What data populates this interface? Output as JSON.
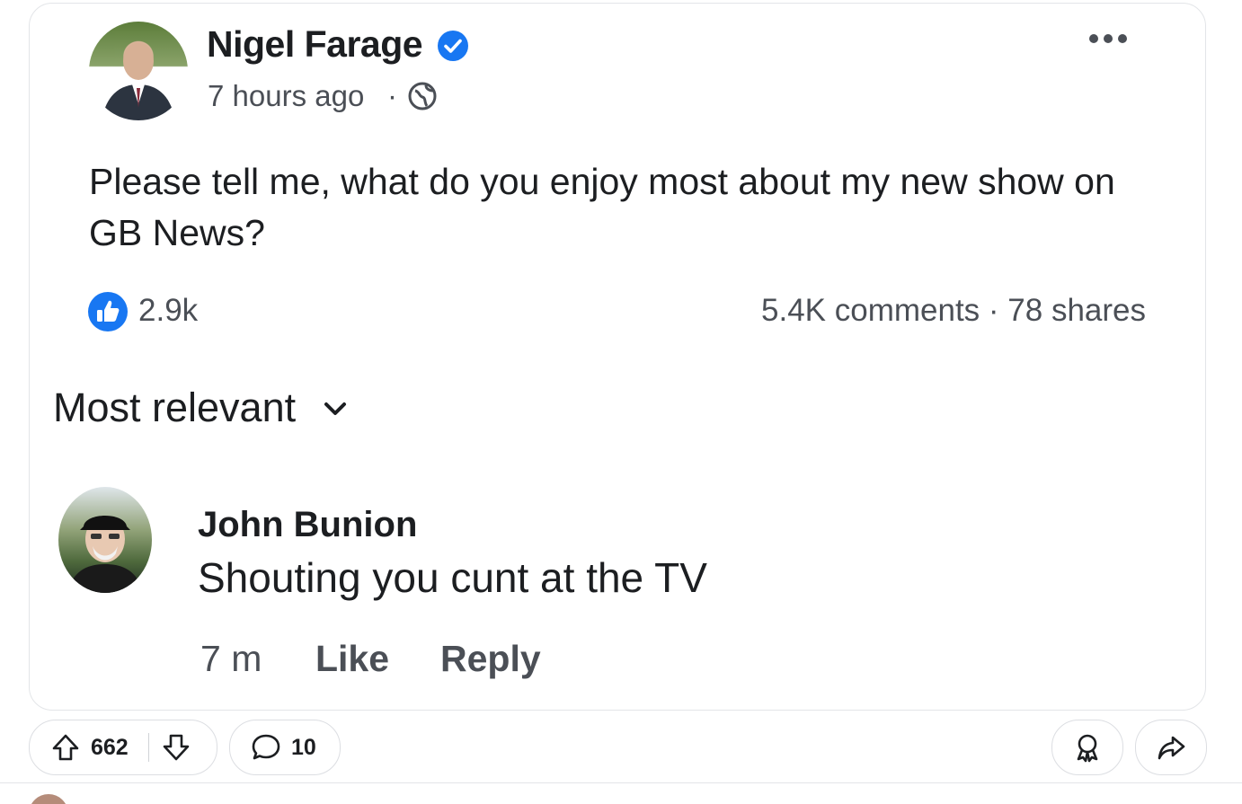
{
  "post": {
    "author": "Nigel Farage",
    "timestamp": "7 hours ago",
    "separator": "·",
    "text": "Please tell me, what do you enjoy most about my new show on GB News?",
    "likes": "2.9k",
    "engagement": "5.4K comments · 78 shares"
  },
  "comments_section": {
    "sort_label": "Most relevant"
  },
  "comment": {
    "author": "John Bunion",
    "text": "Shouting you cunt at the TV",
    "time": "7 m",
    "like_label": "Like",
    "reply_label": "Reply"
  },
  "action_bar": {
    "vote_count": "662",
    "comment_count": "10"
  },
  "icons": {
    "verified": "verified-badge-icon",
    "globe": "globe-icon",
    "more": "more-options-icon",
    "like": "thumbs-up-icon",
    "chevron": "chevron-down-icon",
    "upvote": "upvote-arrow-icon",
    "downvote": "downvote-arrow-icon",
    "comment": "comment-bubble-icon",
    "award": "award-icon",
    "share": "share-arrow-icon"
  },
  "colors": {
    "facebook_blue": "#1877f2",
    "text_primary": "#1c1e21",
    "text_secondary": "#4b4f56"
  }
}
